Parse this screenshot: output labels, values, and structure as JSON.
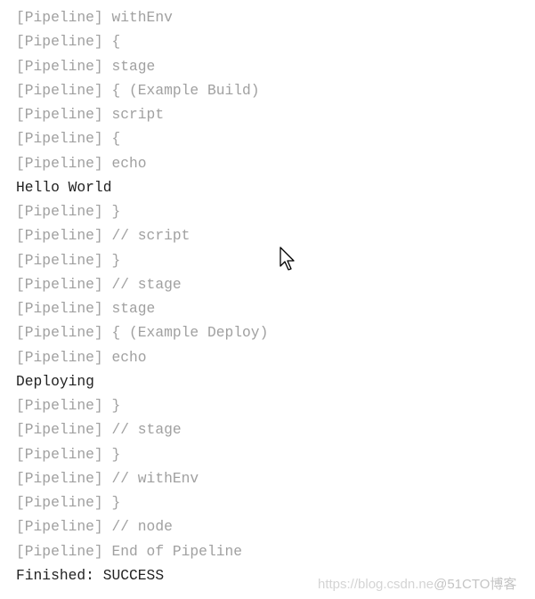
{
  "console": {
    "lines": [
      {
        "text": "[Pipeline] withEnv",
        "kind": "pipeline"
      },
      {
        "text": "[Pipeline] {",
        "kind": "pipeline"
      },
      {
        "text": "[Pipeline] stage",
        "kind": "pipeline"
      },
      {
        "text": "[Pipeline] { (Example Build)",
        "kind": "pipeline"
      },
      {
        "text": "[Pipeline] script",
        "kind": "pipeline"
      },
      {
        "text": "[Pipeline] {",
        "kind": "pipeline"
      },
      {
        "text": "[Pipeline] echo",
        "kind": "pipeline"
      },
      {
        "text": "Hello World",
        "kind": "output"
      },
      {
        "text": "[Pipeline] }",
        "kind": "pipeline"
      },
      {
        "text": "[Pipeline] // script",
        "kind": "pipeline"
      },
      {
        "text": "[Pipeline] }",
        "kind": "pipeline"
      },
      {
        "text": "[Pipeline] // stage",
        "kind": "pipeline"
      },
      {
        "text": "[Pipeline] stage",
        "kind": "pipeline"
      },
      {
        "text": "[Pipeline] { (Example Deploy)",
        "kind": "pipeline"
      },
      {
        "text": "[Pipeline] echo",
        "kind": "pipeline"
      },
      {
        "text": "Deploying",
        "kind": "output"
      },
      {
        "text": "[Pipeline] }",
        "kind": "pipeline"
      },
      {
        "text": "[Pipeline] // stage",
        "kind": "pipeline"
      },
      {
        "text": "[Pipeline] }",
        "kind": "pipeline"
      },
      {
        "text": "[Pipeline] // withEnv",
        "kind": "pipeline"
      },
      {
        "text": "[Pipeline] }",
        "kind": "pipeline"
      },
      {
        "text": "[Pipeline] // node",
        "kind": "pipeline"
      },
      {
        "text": "[Pipeline] End of Pipeline",
        "kind": "pipeline"
      },
      {
        "text": "Finished: SUCCESS",
        "kind": "output"
      }
    ]
  },
  "watermark": {
    "url": "https://blog.csdn.ne",
    "brand": "@51CTO博客"
  },
  "colors": {
    "pipeline_text": "#a0a0a0",
    "output_text": "#222222"
  },
  "icons": {
    "cursor": "mouse-pointer-icon"
  }
}
